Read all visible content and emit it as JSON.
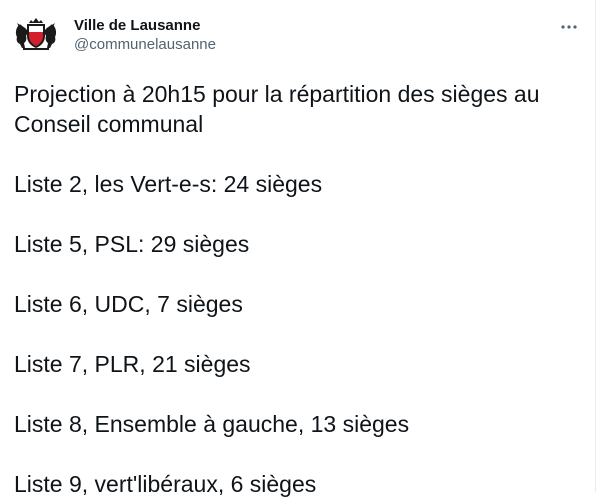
{
  "account": {
    "display_name": "Ville de Lausanne",
    "handle": "@communelausanne",
    "avatar_icon": "lausanne-coat-of-arms-icon"
  },
  "menu": {
    "more_icon": "more-horizontal-icon"
  },
  "tweet": {
    "intro": "Projection à 20h15 pour la répartition des sièges au Conseil communal",
    "lines": [
      "Liste 2, les Vert-e-s: 24 sièges",
      "Liste 5, PSL: 29 sièges",
      "Liste 6, UDC, 7 sièges",
      "Liste 7, PLR, 21 sièges",
      "Liste 8, Ensemble à gauche, 13 sièges",
      "Liste 9, vert'libéraux, 6 sièges"
    ]
  },
  "colors": {
    "text_primary": "#0f1419",
    "text_secondary": "#536471",
    "shield_red": "#d21f2b",
    "shield_white": "#ffffff"
  }
}
